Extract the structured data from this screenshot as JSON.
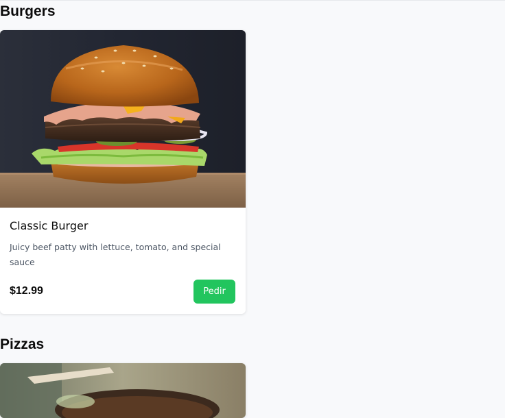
{
  "sections": [
    {
      "title": "Burgers",
      "items": [
        {
          "name": "Classic Burger",
          "description": "Juicy beef patty with lettuce, tomato, and special sauce",
          "price": "$12.99",
          "order_label": "Pedir",
          "photo": "burger-photo"
        }
      ]
    },
    {
      "title": "Pizzas",
      "items": [
        {
          "photo": "pizza-photo"
        }
      ]
    }
  ],
  "colors": {
    "page_background": "#f8f9fb",
    "card_background": "#ffffff",
    "order_button": "#22c55e",
    "description_text": "#4b5563"
  }
}
